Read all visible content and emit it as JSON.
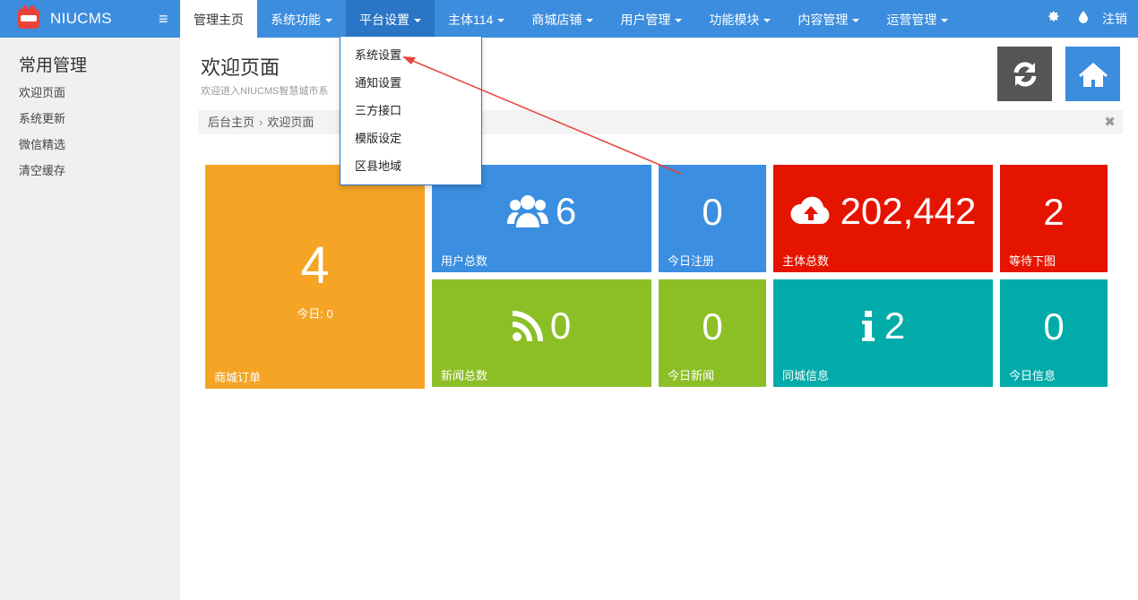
{
  "brand": {
    "name": "NIUCMS",
    "logo_text": "NIUCMS"
  },
  "nav": {
    "items": [
      {
        "label": "管理主页"
      },
      {
        "label": "系统功能"
      },
      {
        "label": "平台设置"
      },
      {
        "label": "主体114"
      },
      {
        "label": "商城店铺"
      },
      {
        "label": "用户管理"
      },
      {
        "label": "功能模块"
      },
      {
        "label": "内容管理"
      },
      {
        "label": "运营管理"
      }
    ],
    "logout": "注销"
  },
  "dropdown": {
    "items": [
      {
        "label": "系统设置"
      },
      {
        "label": "通知设置"
      },
      {
        "label": "三方接口"
      },
      {
        "label": "模版设定"
      },
      {
        "label": "区县地域"
      }
    ]
  },
  "sidebar": {
    "heading": "常用管理",
    "links": [
      {
        "label": "欢迎页面"
      },
      {
        "label": "系统更新"
      },
      {
        "label": "微信精选"
      },
      {
        "label": "清空缓存"
      }
    ]
  },
  "page": {
    "title": "欢迎页面",
    "subtitle": "欢迎进入NIUCMS智慧城市系"
  },
  "breadcrumb": {
    "home": "后台主页",
    "sep": "›",
    "current": "欢迎页面"
  },
  "tiles": {
    "orders": {
      "value": "4",
      "today": "今日: 0",
      "label": "商城订单"
    },
    "users": {
      "value": "6",
      "label": "用户总数",
      "icon": "users-icon"
    },
    "reg_today": {
      "value": "0",
      "label": "今日注册"
    },
    "subjects": {
      "value": "202,442",
      "label": "主体总数",
      "icon": "cloud-upload-icon"
    },
    "pending": {
      "value": "2",
      "label": "等待下图"
    },
    "news": {
      "value": "0",
      "label": "新闻总数",
      "icon": "rss-icon"
    },
    "news_today": {
      "value": "0",
      "label": "今日新闻"
    },
    "city_info": {
      "value": "2",
      "label": "同城信息",
      "icon": "info-icon"
    },
    "info_today": {
      "value": "0",
      "label": "今日信息"
    }
  },
  "colors": {
    "topbar": "#3c8dde",
    "orange": "#f5a425",
    "blue": "#3b8ee0",
    "red": "#e51400",
    "green": "#8cbf26",
    "teal": "#00aba9",
    "annotation_arrow": "#e8423b"
  }
}
